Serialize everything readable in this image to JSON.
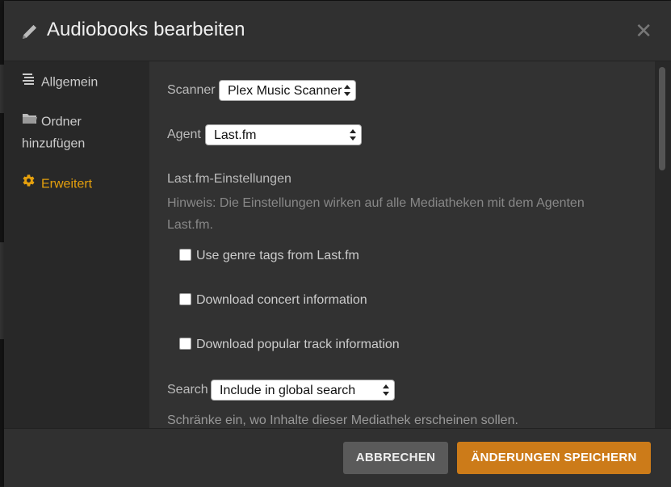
{
  "modal": {
    "title": "Audiobooks bearbeiten",
    "close_icon": "close-icon"
  },
  "sidebar": {
    "items": [
      {
        "label": "Allgemein",
        "icon": "list-icon",
        "active": false
      },
      {
        "label": "Ordner hinzufügen",
        "icon": "folder-icon",
        "active": false
      },
      {
        "label": "Erweitert",
        "icon": "gear-icon",
        "active": true
      }
    ]
  },
  "form": {
    "scanner_label": "Scanner",
    "scanner_value": "Plex Music Scanner",
    "agent_label": "Agent",
    "agent_value": "Last.fm",
    "lastfm_title": "Last.fm-Einstellungen",
    "lastfm_hint": "Hinweis: Die Einstellungen wirken auf alle Mediatheken mit dem Agenten Last.fm.",
    "checkboxes": [
      {
        "label": "Use genre tags from Last.fm",
        "checked": false
      },
      {
        "label": "Download concert information",
        "checked": false
      },
      {
        "label": "Download popular track information",
        "checked": false
      }
    ],
    "search_label": "Search",
    "search_value": "Include in global search",
    "search_hint": "Schränke ein, wo Inhalte dieser Mediathek erscheinen sollen."
  },
  "footer": {
    "cancel_label": "ABBRECHEN",
    "save_label": "ÄNDERUNGEN SPEICHERN"
  },
  "colors": {
    "accent": "#e5a00d",
    "save_button": "#cc7b19",
    "cancel_button": "#5a5a5a"
  }
}
